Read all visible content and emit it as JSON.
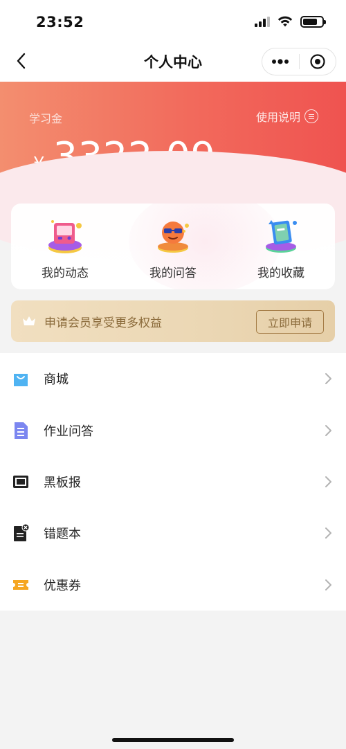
{
  "status_bar": {
    "time": "23:52"
  },
  "nav": {
    "title": "个人中心"
  },
  "wallet": {
    "label": "学习金",
    "help_label": "使用说明",
    "currency": "¥",
    "amount": "3322.09"
  },
  "quick_actions": [
    {
      "label": "我的动态",
      "icon": "game-machine-icon"
    },
    {
      "label": "我的问答",
      "icon": "sunglasses-face-icon"
    },
    {
      "label": "我的收藏",
      "icon": "book-icon"
    }
  ],
  "member_banner": {
    "text": "申请会员享受更多权益",
    "button_label": "立即申请",
    "icon": "crown-icon"
  },
  "menu": [
    {
      "label": "商城",
      "icon": "shopping-bag-icon",
      "color": "#4fb3f2"
    },
    {
      "label": "作业问答",
      "icon": "document-icon",
      "color": "#7b86f0"
    },
    {
      "label": "黑板报",
      "icon": "blackboard-icon",
      "color": "#222222"
    },
    {
      "label": "错题本",
      "icon": "mistake-notebook-icon",
      "color": "#222222"
    },
    {
      "label": "优惠券",
      "icon": "coupon-icon",
      "color": "#f5a623"
    }
  ],
  "colors": {
    "hero_start": "#f38e6f",
    "hero_end": "#ef5350",
    "member_text": "#8a6a3a"
  }
}
